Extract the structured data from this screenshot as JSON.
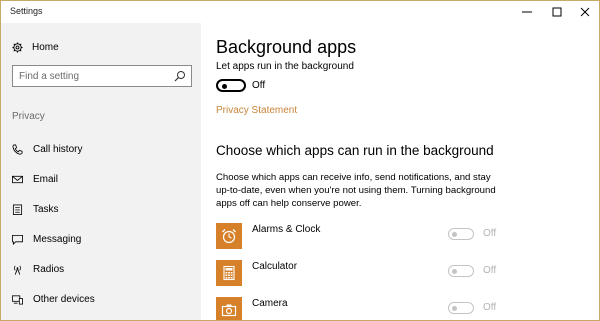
{
  "window": {
    "title": "Settings"
  },
  "sidebar": {
    "home_label": "Home",
    "search_placeholder": "Find a setting",
    "section_label": "Privacy",
    "items": [
      {
        "label": "Call history",
        "icon": "call-history-icon"
      },
      {
        "label": "Email",
        "icon": "mail-icon"
      },
      {
        "label": "Tasks",
        "icon": "tasks-icon"
      },
      {
        "label": "Messaging",
        "icon": "messaging-icon"
      },
      {
        "label": "Radios",
        "icon": "radio-tower-icon"
      },
      {
        "label": "Other devices",
        "icon": "devices-icon"
      }
    ]
  },
  "content": {
    "title": "Background apps",
    "toggle_label": "Let apps run in the background",
    "toggle_state": "Off",
    "privacy_link": "Privacy Statement",
    "section_title": "Choose which apps can run in the background",
    "description": "Choose which apps can receive info, send notifications, and stay up-to-date, even when you're not using them. Turning background apps off can help conserve power.",
    "apps": [
      {
        "name": "Alarms & Clock",
        "state": "Off",
        "icon": "alarm-clock-icon"
      },
      {
        "name": "Calculator",
        "state": "Off",
        "icon": "calculator-icon"
      },
      {
        "name": "Camera",
        "state": "Off",
        "icon": "camera-icon"
      }
    ]
  },
  "colors": {
    "accent": "#c8843a",
    "app_tile": "#d6802a",
    "sidebar_bg": "#f2f2f2"
  }
}
